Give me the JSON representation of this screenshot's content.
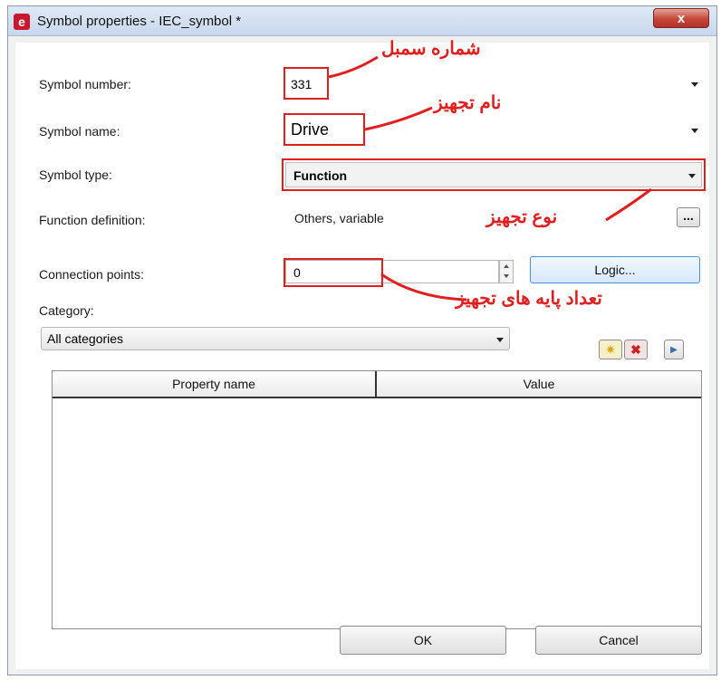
{
  "window": {
    "title": "Symbol properties - IEC_symbol *",
    "close_label": "x",
    "app_icon": "e"
  },
  "fields": {
    "symbol_number": {
      "label": "Symbol number:",
      "value": "331",
      "annotation": "شماره سمبل"
    },
    "symbol_name": {
      "label": "Symbol name:",
      "value": "Drive",
      "annotation": "نام تجهیز"
    },
    "symbol_type": {
      "label": "Symbol type:",
      "value": "Function",
      "annotation": "نوع تجهیز"
    },
    "function_definition": {
      "label": "Function definition:",
      "value": "Others, variable",
      "browse_label": "..."
    },
    "connection_points": {
      "label": "Connection points:",
      "value": "0",
      "annotation": "تعداد پایه های تجهیز",
      "logic_button": "Logic..."
    },
    "category": {
      "label": "Category:",
      "value": "All categories"
    }
  },
  "properties_table": {
    "columns": [
      "Property name",
      "Value"
    ],
    "rows": []
  },
  "buttons": {
    "ok": "OK",
    "cancel": "Cancel"
  },
  "colors": {
    "annotation": "#e02020",
    "app_icon": "#c8182e",
    "close_button": "#c4463a"
  }
}
